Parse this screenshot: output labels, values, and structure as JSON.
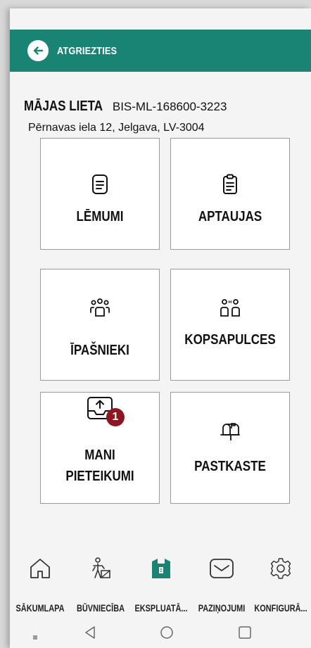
{
  "appbar": {
    "back_label": "ATGRIEZTIES",
    "color": "#1a8474"
  },
  "house": {
    "title": "MĀJAS LIETA",
    "id": "BIS-ML-168600-3223",
    "address": "Pērnavas iela 12, Jelgava, LV-3004"
  },
  "tiles": [
    {
      "label": "LĒMUMI",
      "icon": "document-lines-icon"
    },
    {
      "label": "APTAUJAS",
      "icon": "clipboard-icon"
    },
    {
      "label": "ĪPAŠNIEKI",
      "icon": "people-group-icon"
    },
    {
      "label": "KOPSAPULCES",
      "icon": "meeting-icon"
    },
    {
      "label_line1": "MANI",
      "label_line2": "PIETEIKUMI",
      "icon": "upload-tray-icon",
      "badge": "1"
    },
    {
      "label": "PASTKASTE",
      "icon": "mailbox-icon"
    }
  ],
  "bottom_nav": [
    {
      "label": "SĀKUMLAPA",
      "icon": "home-icon"
    },
    {
      "label": "BŪVNIECĪBA",
      "icon": "construction-icon"
    },
    {
      "label": "EKSPLUATĀ...",
      "icon": "building-icon",
      "active": true
    },
    {
      "label": "PAZIŅOJUMI",
      "icon": "envelope-icon"
    },
    {
      "label": "KONFIGURĀ...",
      "icon": "gear-icon"
    }
  ],
  "colors": {
    "accent": "#1a8474",
    "badge": "#8e1623",
    "text": "#111111"
  }
}
